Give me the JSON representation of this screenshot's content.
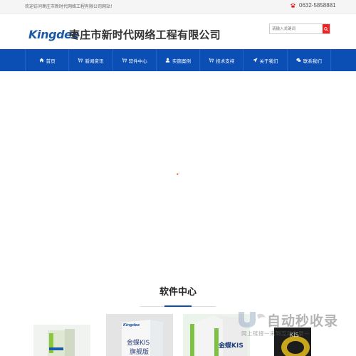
{
  "topbar": {
    "welcome": "欢迎访问枣庄市新时代网络工程有限公司网站！",
    "phone": "0632-5858881"
  },
  "header": {
    "logo": "Kingdee",
    "company_name": "枣庄市新时代网络工程有限公司",
    "search_placeholder": "请输入关键词"
  },
  "nav": {
    "items": [
      {
        "label": "首页",
        "icon": "home-icon"
      },
      {
        "label": "新闻资讯",
        "icon": "cart-icon"
      },
      {
        "label": "软件中心",
        "icon": "cart-icon"
      },
      {
        "label": "实施案例",
        "icon": "user-icon"
      },
      {
        "label": "技术支持",
        "icon": "cart-icon"
      },
      {
        "label": "关于我们",
        "icon": "send-icon"
      },
      {
        "label": "联系我们",
        "icon": "chat-icon"
      }
    ]
  },
  "section": {
    "title": "软件中心"
  },
  "products": [
    {
      "brand": "",
      "name": ""
    },
    {
      "brand": "Kingdee",
      "name": "金蝶KIS",
      "edition": "旗舰版"
    },
    {
      "brand": "",
      "name": "金蝶KIS"
    },
    {
      "brand": "",
      "name": "KIS"
    }
  ],
  "watermark": {
    "title": "自动秒收录",
    "subtitle": "网上链接一来到互动收录一"
  },
  "colors": {
    "nav_bg": "#0b4fb5",
    "logo": "#1a5aa8",
    "search_button": "#e22222"
  }
}
